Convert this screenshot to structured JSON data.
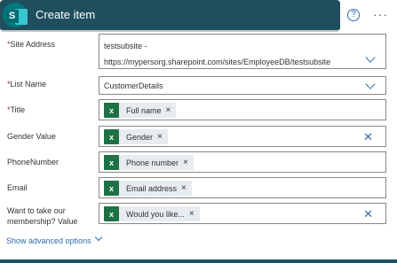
{
  "header": {
    "title": "Create item",
    "logo_letter": "S",
    "help_glyph": "?",
    "more_glyph": "···"
  },
  "fields": {
    "site_address": {
      "label": "Site Address",
      "required": "*",
      "value_line1": "testsubsite -",
      "value_line2": "https://mypersorg.sharepoint.com/sites/EmployeeDB/testsubsite"
    },
    "list_name": {
      "label": "List Name",
      "required": "*",
      "value": "CustomerDetails"
    },
    "title": {
      "label": "Title",
      "required": "*",
      "token": "Full name"
    },
    "gender": {
      "label": "Gender Value",
      "token": "Gender"
    },
    "phone": {
      "label": "PhoneNumber",
      "token": "Phone number"
    },
    "email": {
      "label": "Email",
      "token": "Email address"
    },
    "membership": {
      "label_line1": "Want to take our",
      "label_line2": "membership? Value",
      "token": "Would you like..."
    }
  },
  "token_icon_glyph": "x",
  "remove_glyph": "×",
  "clear_glyph": "✕",
  "advanced_options_label": "Show advanced options",
  "icons": {
    "logo": "sharepoint-logo-icon",
    "help": "help-circle-icon",
    "more": "more-options-icon",
    "dropdown": "chevron-down-icon",
    "token": "excel-icon",
    "clear": "clear-icon"
  },
  "colors": {
    "header_bg": "#1f4e5e",
    "accent": "#2b6cb0",
    "required": "#a4262c",
    "excel": "#1e7145",
    "token_bg": "#e6ecf0"
  }
}
